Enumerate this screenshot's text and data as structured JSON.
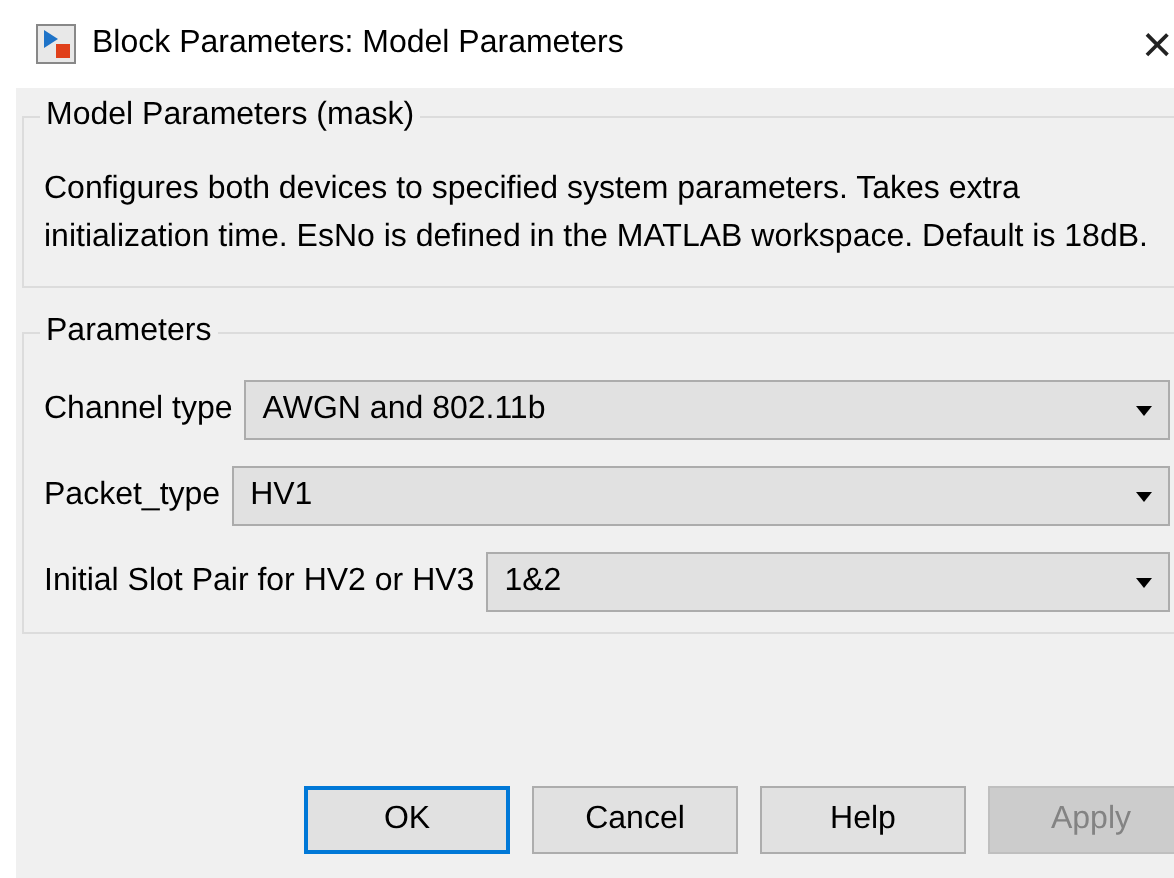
{
  "window": {
    "title": "Block Parameters: Model Parameters",
    "close": "×"
  },
  "mask_group": {
    "title": "Model Parameters (mask)",
    "description": "Configures both devices to specified system parameters. Takes extra initialization time. EsNo is defined in the MATLAB workspace. Default is 18dB."
  },
  "parameters_group": {
    "title": "Parameters",
    "fields": [
      {
        "label": "Channel type",
        "value": "AWGN and 802.11b"
      },
      {
        "label": "Packet_type",
        "value": "HV1"
      },
      {
        "label": "Initial Slot Pair for HV2 or HV3",
        "value": "1&2"
      }
    ]
  },
  "buttons": [
    {
      "label": "OK",
      "focused": true,
      "disabled": false
    },
    {
      "label": "Cancel",
      "focused": false,
      "disabled": false
    },
    {
      "label": "Help",
      "focused": false,
      "disabled": false
    },
    {
      "label": "Apply",
      "focused": false,
      "disabled": true
    }
  ]
}
